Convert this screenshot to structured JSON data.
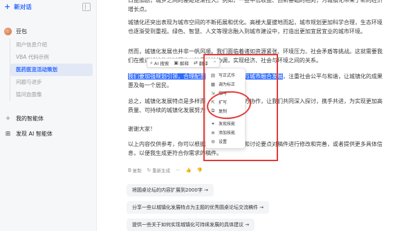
{
  "sidebar": {
    "new_chat": "新对话",
    "bot_name": "豆包",
    "items": [
      "用户信息介绍",
      "VBA 代码示例",
      "医药医览活动策划",
      "问题与进步",
      "猛问血面像"
    ],
    "my_agents": "我的智能体",
    "discover_agents": "发现 AI 智能体"
  },
  "content": {
    "para0": "日益加剧，城乡之间的差距逐渐拉大。例如，一些中低收益、创新基础的相对，为城镇化带来了新的经济增长点。",
    "para1": "城镇化还突出表现为城市空间的不断拓展和优化。高楼大厦拔地而起，城市规划更加科学合理，生态环境也逐渐受到重视。绿色、智慧、人文等理念融入到城市建设中，打造出更加宜居宜业的城市环境。",
    "para2": "然而，城镇化发展也并非一帆风顺。我们面临着诸如资源紧张、环境压力、社会矛盾等挑战。这就需要我们在推进城镇化的",
    "para2_tail": "过程中，注重统筹协调，实现经济、社会与环境之间的关系。",
    "para3_highlight": "我们要加强规划引领，合理配置资源，推动产业与城市融合发展",
    "para3_rest": "，注重社会公平与和谐，让城镇化的成果惠及每一个居民。",
    "para4": "总之，城镇化发展特点是多样而复杂的，需要各方协作，让我们共同深入探讨，携手共进，为实现更加高质量、可持续的城镇化发展努力。",
    "para5": "谢谢大家！",
    "para6": "以上内容仅供参考，你可以根据具体的论坛主题和讨论要点对稿件进行修改和完善，或者提供更多具体信息，以便我生成更符合你需求的稿件。"
  },
  "toolbar": {
    "ai_search": "AI 搜索",
    "ai_search_icon": "search-icon",
    "explain": "解释",
    "explain_icon": "book-icon",
    "translate": "翻译",
    "translate_icon": "translate-icon",
    "more_icon": "chevron-up-icon"
  },
  "menu": {
    "items": [
      "写正式作",
      "调为标正",
      "缩写",
      "扩写",
      "复制"
    ],
    "items2": [
      "发现技能",
      "添加技能",
      "设置"
    ]
  },
  "actions": {
    "copy": "复制",
    "regenerate": "重新生成"
  },
  "suggestions": [
    "将圆桌论坛的内容扩展到2000字 →",
    "分享一些以城镇化发展特点为主题的优秀圆桌论坛交流稿件 →",
    "提供一些关于如何实现城镇化可持续发展的具体建议 →"
  ],
  "colors": {
    "accent": "#2f6bff",
    "annotation": "#e53935"
  }
}
